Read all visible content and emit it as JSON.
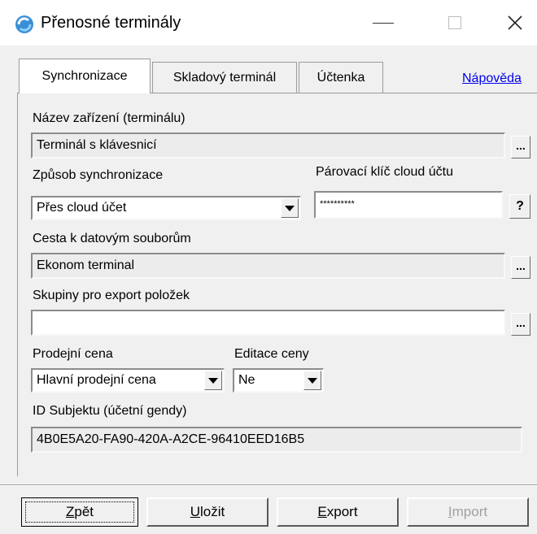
{
  "window": {
    "title": "Přenosné terminály",
    "minimize": "—",
    "close": "✕"
  },
  "tabs": [
    {
      "label": "Synchronizace",
      "active": true
    },
    {
      "label": "Skladový terminál",
      "active": false
    },
    {
      "label": "Účtenka",
      "active": false
    }
  ],
  "help_link": "Nápověda",
  "device_name": {
    "label": "Název zařízení (terminálu)",
    "value": "Terminál s klávesnicí",
    "browse": "..."
  },
  "sync_method": {
    "label": "Způsob synchronizace",
    "value": "Přes cloud účet"
  },
  "pairing_key": {
    "label": "Párovací klíč cloud účtu",
    "value": "**********",
    "help": "?"
  },
  "data_path": {
    "label": "Cesta k datovým souborům",
    "value": "Ekonom terminal",
    "browse": "..."
  },
  "export_groups": {
    "label": "Skupiny pro export položek",
    "value": "",
    "browse": "..."
  },
  "sale_price": {
    "label": "Prodejní cena",
    "value": "Hlavní prodejní cena"
  },
  "price_edit": {
    "label": "Editace ceny",
    "value": "Ne"
  },
  "subject_id": {
    "label": "ID Subjektu (účetní gendy)",
    "value": "4B0E5A20-FA90-420A-A2CE-96410EED16B5"
  },
  "buttons": {
    "back": {
      "hotkey": "Z",
      "rest": "pět"
    },
    "save": {
      "hotkey": "U",
      "rest": "ložit"
    },
    "export": {
      "hotkey": "E",
      "rest": "xport"
    },
    "import": {
      "hotkey": "I",
      "rest": "mport",
      "disabled": true
    }
  },
  "colors": {
    "link": "#0000ee",
    "disabled_text": "#a0a0a0",
    "face": "#f0f0f0"
  }
}
